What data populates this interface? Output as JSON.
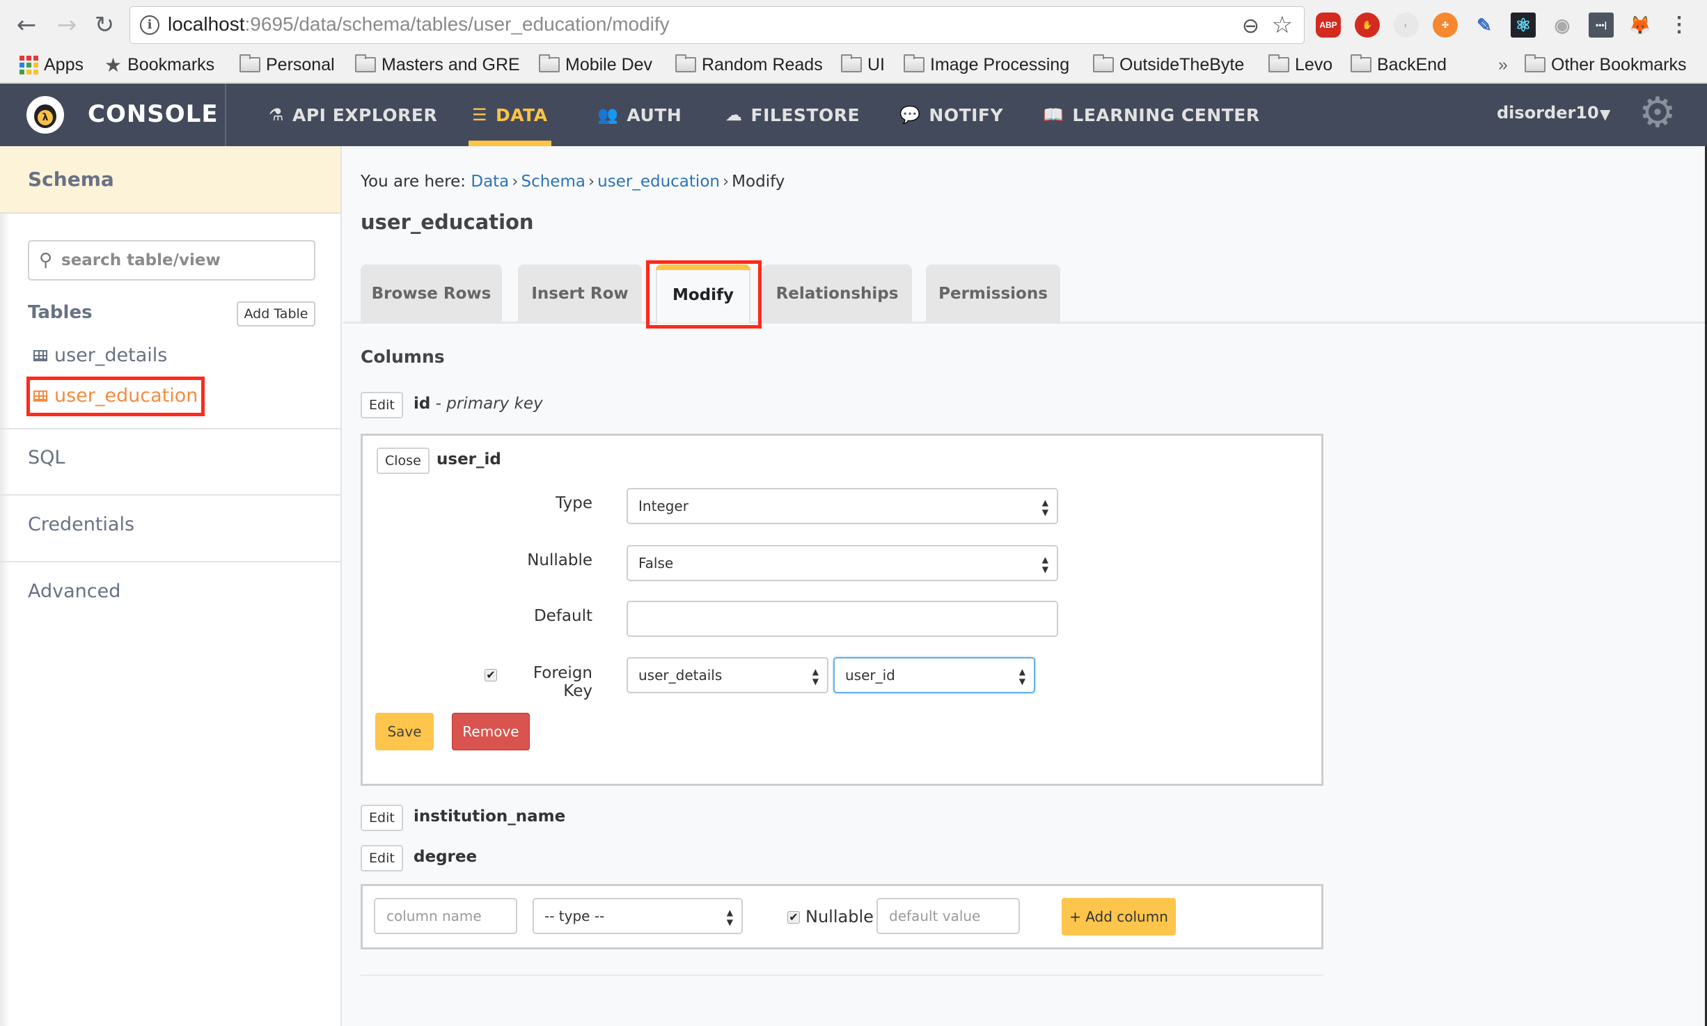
{
  "browser": {
    "back_icon": "arrow-left-icon",
    "forward_icon": "arrow-right-icon",
    "reload_icon": "reload-icon",
    "url_host": "localhost",
    "url_rest": ":9695/data/schema/tables/user_education/modify",
    "extensions": [
      "ABP",
      "stop-hand",
      "privacy-badger",
      "orange-hub",
      "eyedropper",
      "react-devtools",
      "podcast",
      "lastpass",
      "metamask"
    ],
    "bookmarks": [
      "Apps",
      "Bookmarks",
      "Personal",
      "Masters and GRE",
      "Mobile Dev",
      "Random Reads",
      "UI",
      "Image Processing",
      "OutsideTheByte",
      "Levo",
      "BackEnd"
    ],
    "overflow": "»",
    "other_bookmarks": "Other Bookmarks"
  },
  "header": {
    "brand": "CONSOLE",
    "nav": [
      {
        "label": "API EXPLORER",
        "icon": "flask-icon"
      },
      {
        "label": "DATA",
        "icon": "database-icon",
        "active": true
      },
      {
        "label": "AUTH",
        "icon": "users-icon"
      },
      {
        "label": "FILESTORE",
        "icon": "cloud-upload-icon"
      },
      {
        "label": "NOTIFY",
        "icon": "comment-icon"
      },
      {
        "label": "LEARNING CENTER",
        "icon": "book-icon"
      }
    ],
    "user": "disorder10",
    "accent": "#fdc446",
    "bg": "#434a5b"
  },
  "sidebar": {
    "title": "Schema",
    "search_placeholder": "search table/view",
    "tables_label": "Tables",
    "add_table": "Add Table",
    "tables": [
      {
        "name": "user_details",
        "active": false
      },
      {
        "name": "user_education",
        "active": true
      }
    ],
    "links": [
      "SQL",
      "Credentials",
      "Advanced"
    ]
  },
  "main": {
    "breadcrumb": {
      "prefix": "You are here:",
      "items": [
        "Data",
        "Schema",
        "user_education"
      ],
      "current": "Modify"
    },
    "title": "user_education",
    "tabs": [
      "Browse Rows",
      "Insert Row",
      "Modify",
      "Relationships",
      "Permissions"
    ],
    "active_tab": "Modify",
    "columns_title": "Columns",
    "columns": [
      {
        "button": "Edit",
        "name": "id",
        "suffix": " - primary key"
      },
      {
        "button": "Close",
        "name": "user_id",
        "expanded": true
      },
      {
        "button": "Edit",
        "name": "institution_name"
      },
      {
        "button": "Edit",
        "name": "degree"
      }
    ],
    "editor": {
      "type_label": "Type",
      "type_value": "Integer",
      "nullable_label": "Nullable",
      "nullable_value": "False",
      "default_label": "Default",
      "default_value": "",
      "fk_label": "Foreign Key",
      "fk_checked": true,
      "fk_table": "user_details",
      "fk_column": "user_id",
      "save": "Save",
      "remove": "Remove"
    },
    "add_column": {
      "name_placeholder": "column name",
      "type_value": "-- type --",
      "nullable_label": "Nullable",
      "nullable_checked": true,
      "default_placeholder": "default value",
      "button": "+ Add column"
    }
  }
}
